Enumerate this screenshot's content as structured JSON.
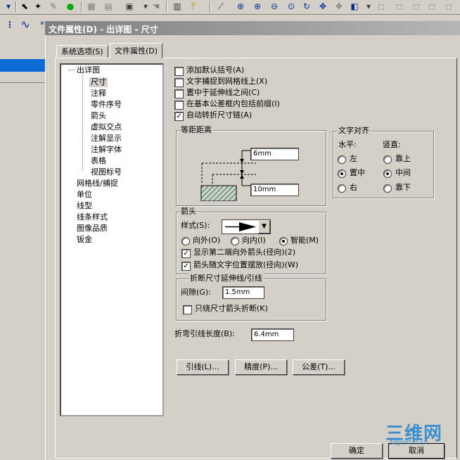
{
  "window": {
    "title": "文件属性(D) - 出详图 - 尺寸"
  },
  "tabs": [
    {
      "label": "系统选项(S)"
    },
    {
      "label": "文件属性(D)"
    }
  ],
  "tree": {
    "root": "出详图",
    "children": [
      "尺寸",
      "注释",
      "零件序号",
      "箭头",
      "虚拟交点",
      "注解显示",
      "注解字体",
      "表格",
      "视图标号"
    ],
    "others": [
      "网格线/捕捉",
      "单位",
      "线型",
      "线条样式",
      "图像品质",
      "钣金"
    ],
    "selected": "尺寸"
  },
  "options": [
    {
      "label": "添加默认括号(A)",
      "checked": false
    },
    {
      "label": "文字捕捉到网格线上(X)",
      "checked": false
    },
    {
      "label": "置中于延伸线之间(C)",
      "checked": false
    },
    {
      "label": "在基本公差框内包括前缀(I)",
      "checked": false
    },
    {
      "label": "自动转折尺寸链(A)",
      "checked": true
    }
  ],
  "offset_group": {
    "title": "等距距离",
    "upper_value": "6mm",
    "lower_value": "10mm"
  },
  "text_align": {
    "title": "文字对齐",
    "horizontal_label": "水平:",
    "vertical_label": "竖直:",
    "horizontal": [
      {
        "label": "左",
        "on": false
      },
      {
        "label": "置中",
        "on": true
      },
      {
        "label": "右",
        "on": false
      }
    ],
    "vertical": [
      {
        "label": "靠上",
        "on": false
      },
      {
        "label": "中间",
        "on": true
      },
      {
        "label": "靠下",
        "on": false
      }
    ]
  },
  "arrows": {
    "title": "箭头",
    "style_label": "样式(S):",
    "radios": [
      {
        "label": "向外(O)",
        "on": false
      },
      {
        "label": "向内(I)",
        "on": false
      },
      {
        "label": "智能(M)",
        "on": true
      }
    ],
    "checks": [
      {
        "label": "显示第二端向外箭头(径向)(2)",
        "checked": true
      },
      {
        "label": "箭头随文字位置摆放(径向)(W)",
        "checked": true
      }
    ]
  },
  "break_group": {
    "title": "折断尺寸延伸线/引线",
    "gap_label": "间隙(G):",
    "gap_value": "1.5mm",
    "only_label": "只绕尺寸箭头折断(K)",
    "only_checked": false
  },
  "bent_leader": {
    "label": "折弯引线长度(B):",
    "value": "6.4mm"
  },
  "buttons": {
    "leader": "引线(L)...",
    "precision": "精度(P)...",
    "tolerance": "公差(T)...",
    "ok": "确定",
    "cancel": "取消"
  },
  "watermark": {
    "logo": "三维网",
    "url": "3dportal.cn"
  }
}
